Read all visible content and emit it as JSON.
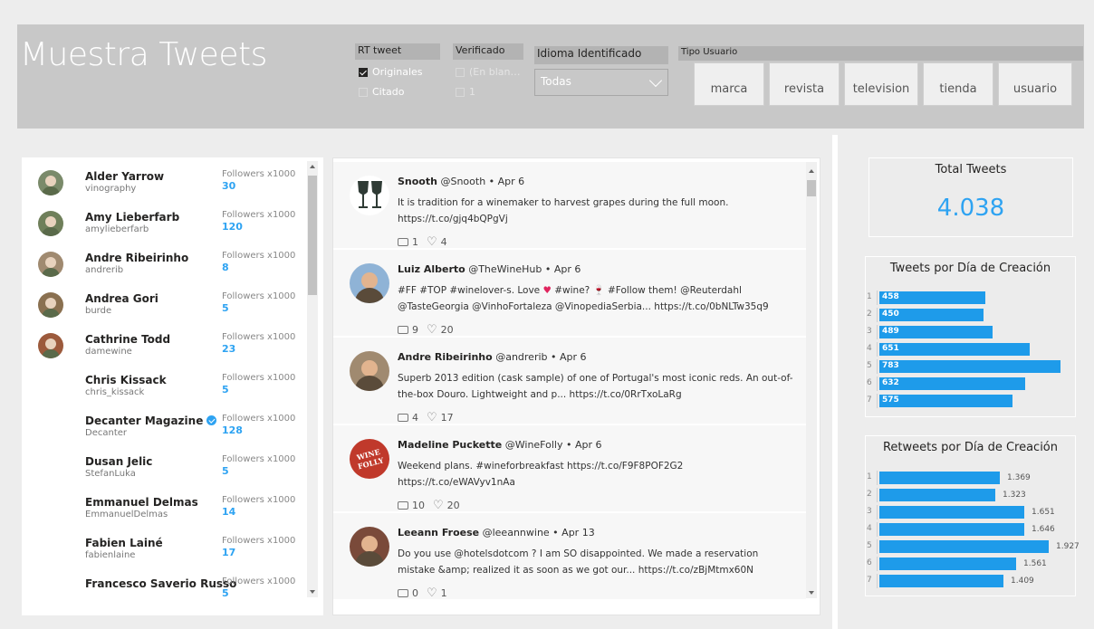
{
  "header": {
    "title": "Muestra Tweets",
    "rt_slicer": {
      "label": "RT tweet",
      "options": [
        {
          "label": "Originales",
          "checked": true
        },
        {
          "label": "Citado",
          "checked": false
        }
      ]
    },
    "verified_slicer": {
      "label": "Verificado",
      "options": [
        {
          "label": "(En blan…",
          "checked": false
        },
        {
          "label": "1",
          "checked": false
        }
      ]
    },
    "language_slicer": {
      "label": "Idioma Identificado",
      "selected": "Todas"
    },
    "user_type_slicer": {
      "label": "Tipo Usuario",
      "buttons": [
        "marca",
        "revista",
        "television",
        "tienda",
        "usuario"
      ]
    }
  },
  "users": {
    "followers_label": "Followers x1000",
    "rows": [
      {
        "name": "Alder Yarrow",
        "handle": "vinography",
        "followers": "30",
        "avatar_color": "#7a8a6a"
      },
      {
        "name": "Amy Lieberfarb",
        "handle": "amylieberfarb",
        "followers": "120",
        "avatar_color": "#6f7f5a"
      },
      {
        "name": "Andre Ribeirinho",
        "handle": "andrerib",
        "followers": "8",
        "avatar_color": "#a08a70"
      },
      {
        "name": "Andrea Gori",
        "handle": "burde",
        "followers": "5",
        "avatar_color": "#8a7050"
      },
      {
        "name": "Cathrine Todd",
        "handle": "damewine",
        "followers": "23",
        "avatar_color": "#9c5a3c"
      },
      {
        "name": "Chris Kissack",
        "handle": "chris_kissack",
        "followers": "5",
        "avatar_color": ""
      },
      {
        "name": "Decanter Magazine",
        "handle": "Decanter",
        "followers": "128",
        "avatar_color": "",
        "verified": true
      },
      {
        "name": "Dusan Jelic",
        "handle": "StefanLuka",
        "followers": "5",
        "avatar_color": ""
      },
      {
        "name": "Emmanuel Delmas",
        "handle": "EmmanuelDelmas",
        "followers": "14",
        "avatar_color": ""
      },
      {
        "name": "Fabien Lainé",
        "handle": "fabienlaine",
        "followers": "17",
        "avatar_color": ""
      },
      {
        "name": "Francesco Saverio Russo",
        "handle": "",
        "followers": "5",
        "avatar_color": ""
      }
    ]
  },
  "tweets": [
    {
      "name": "Snooth",
      "handle": "@Snooth",
      "date": "Apr 6",
      "text": "It is tradition for a winemaker to harvest grapes during the full moon. https://t.co/gjq4bQPgVj",
      "retweets": "1",
      "likes": "4",
      "avatar_color": "#ffffff"
    },
    {
      "name": "Luiz Alberto",
      "handle": "@TheWineHub",
      "date": "Apr 6",
      "text_before_heart": "#FF #TOP #winelover-s. Love ",
      "text": "#wine? 🍷 #Follow them! @Reuterdahl @TasteGeorgia @VinhoFortaleza @VinopediaSerbia... https://t.co/0bNLTw35q9",
      "retweets": "9",
      "likes": "20",
      "avatar_color": "#8fb3d6"
    },
    {
      "name": "Andre Ribeirinho",
      "handle": "@andrerib",
      "date": "Apr 6",
      "text": "Superb 2013 edition (cask sample) of one of Portugal's most iconic reds. An out-of-the-box Douro. Lightweight and p... https://t.co/0RrTxoLaRg",
      "retweets": "4",
      "likes": "17",
      "avatar_color": "#a08a70"
    },
    {
      "name": "Madeline Puckette",
      "handle": "@WineFolly",
      "date": "Apr 6",
      "text": "Weekend plans. #wineforbreakfast https://t.co/F9F8POF2G2 https://t.co/eWAVyv1nAa",
      "retweets": "10",
      "likes": "20",
      "avatar_color": "#c0392b",
      "avatar_text": "WINE FOLLY"
    },
    {
      "name": "Leeann Froese",
      "handle": "@leeannwine",
      "date": "Apr 13",
      "text": "Do you use @hotelsdotcom ? I am SO disappointed. We made a reservation mistake &amp; realized it as soon as we got our... https://t.co/zBjMtmx60N",
      "retweets": "0",
      "likes": "1",
      "avatar_color": "#7a4a3a"
    }
  ],
  "total_card": {
    "title": "Total Tweets",
    "value": "4.038"
  },
  "chart_data": [
    {
      "type": "bar",
      "orientation": "horizontal",
      "title": "Tweets por Día de Creación",
      "categories": [
        "1",
        "2",
        "3",
        "4",
        "5",
        "6",
        "7"
      ],
      "values": [
        458,
        450,
        489,
        651,
        783,
        632,
        575
      ],
      "labels": [
        "458",
        "450",
        "489",
        "651",
        "783",
        "632",
        "575"
      ],
      "color": "#1e9bea"
    },
    {
      "type": "bar",
      "orientation": "horizontal",
      "title": "Retweets por Día de Creación",
      "categories": [
        "1",
        "2",
        "3",
        "4",
        "5",
        "6",
        "7"
      ],
      "values": [
        1369,
        1323,
        1651,
        1646,
        1927,
        1561,
        1409
      ],
      "labels": [
        "1.369",
        "1.323",
        "1.651",
        "1.646",
        "1.927",
        "1.561",
        "1.409"
      ],
      "color": "#1e9bea"
    }
  ]
}
